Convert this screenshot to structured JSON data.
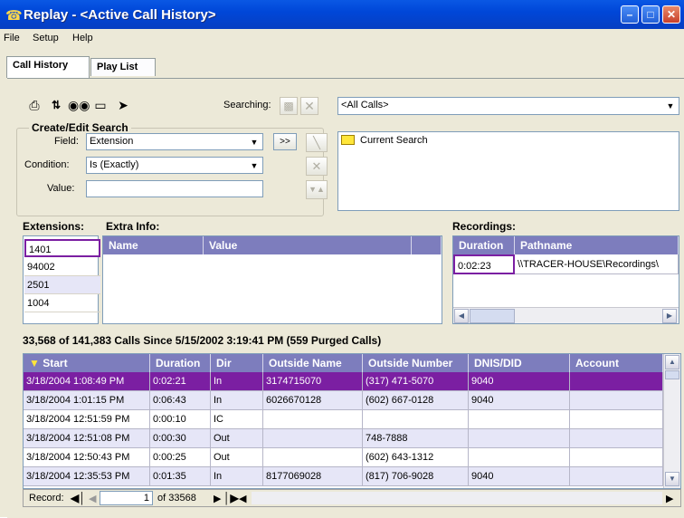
{
  "window": {
    "title": "Replay - <Active Call History>"
  },
  "menu": [
    "File",
    "Setup",
    "Help"
  ],
  "tabs": [
    {
      "label": "Call History",
      "active": true
    },
    {
      "label": "Play List",
      "active": false
    }
  ],
  "toolbar": {
    "icons": [
      "printer-icon",
      "sort-icon",
      "binoculars-icon",
      "tag-icon",
      "eraser-icon"
    ],
    "searching_label": "Searching:",
    "search_dropdown_value": "<All Calls>"
  },
  "search_editor": {
    "group_title": "Create/Edit Search",
    "field_label": "Field:",
    "field_value": "Extension",
    "condition_label": "Condition:",
    "condition_value": "Is (Exactly)",
    "value_label": "Value:",
    "value_value": "",
    "add_button": ">>",
    "tree_item": "Current Search"
  },
  "extensions": {
    "label": "Extensions:",
    "items": [
      "1401",
      "94002",
      "2501",
      "1004"
    ]
  },
  "extra_info": {
    "label": "Extra Info:",
    "columns": [
      "Name",
      "Value"
    ]
  },
  "recordings": {
    "label": "Recordings:",
    "columns": [
      "Duration",
      "Pathname"
    ],
    "rows": [
      {
        "duration": "0:02:23",
        "pathname": "\\\\TRACER-HOUSE\\Recordings\\"
      }
    ]
  },
  "calls": {
    "summary": "33,568 of 141,383 Calls Since 5/15/2002 3:19:41 PM (559 Purged Calls)",
    "columns": [
      "Start",
      "Duration",
      "Dir",
      "Outside Name",
      "Outside Number",
      "DNIS/DID",
      "Account"
    ],
    "rows": [
      {
        "start": "3/18/2004 1:08:49 PM",
        "duration": "0:02:21",
        "dir": "In",
        "outside_name": "3174715070",
        "outside_number": "(317) 471-5070",
        "dnis": "9040",
        "account": ""
      },
      {
        "start": "3/18/2004 1:01:15 PM",
        "duration": "0:06:43",
        "dir": "In",
        "outside_name": "6026670128",
        "outside_number": "(602) 667-0128",
        "dnis": "9040",
        "account": ""
      },
      {
        "start": "3/18/2004 12:51:59 PM",
        "duration": "0:00:10",
        "dir": "IC",
        "outside_name": "",
        "outside_number": "",
        "dnis": "",
        "account": ""
      },
      {
        "start": "3/18/2004 12:51:08 PM",
        "duration": "0:00:30",
        "dir": "Out",
        "outside_name": "",
        "outside_number": "748-7888",
        "dnis": "",
        "account": ""
      },
      {
        "start": "3/18/2004 12:50:43 PM",
        "duration": "0:00:25",
        "dir": "Out",
        "outside_name": "",
        "outside_number": "(602) 643-1312",
        "dnis": "",
        "account": ""
      },
      {
        "start": "3/18/2004 12:35:53 PM",
        "duration": "0:01:35",
        "dir": "In",
        "outside_name": "8177069028",
        "outside_number": "(817) 706-9028",
        "dnis": "9040",
        "account": ""
      }
    ],
    "selected_row": 0
  },
  "record_nav": {
    "label": "Record:",
    "current": "1",
    "total": "of 33568"
  },
  "colors": {
    "title_blue": "#0a58e4",
    "header_purple": "#7d7dbd",
    "selected_row": "#7b1fa2",
    "row_alt": "#e6e6f7"
  }
}
